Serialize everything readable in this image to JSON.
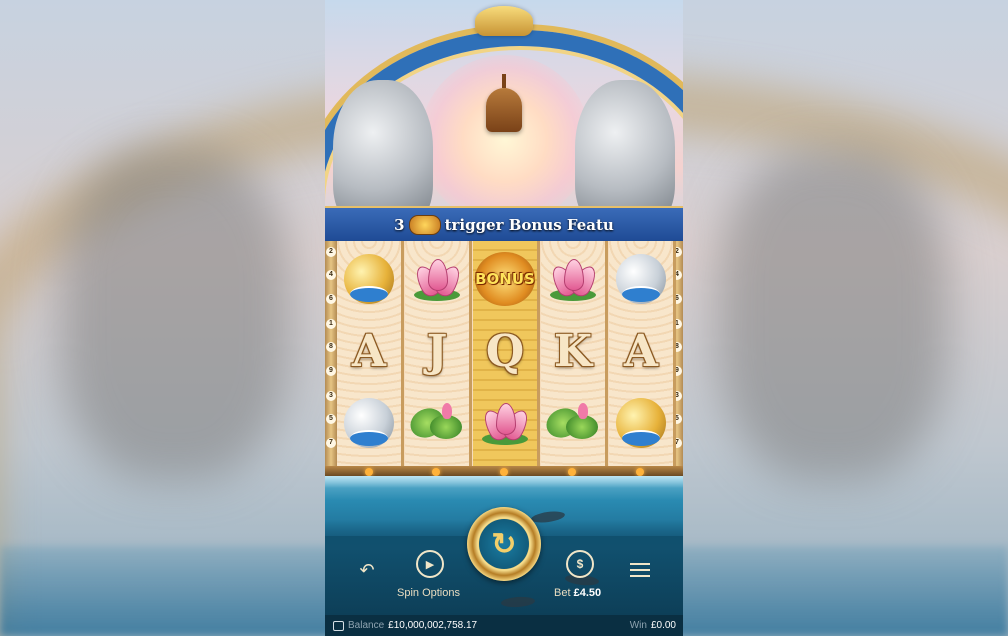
{
  "banner": {
    "prefix": "3",
    "text": "trigger Bonus Featu"
  },
  "reels": {
    "columns": [
      [
        "gold-koi",
        "A",
        "silver-koi"
      ],
      [
        "lotus",
        "J",
        "lotus-leaf"
      ],
      [
        "bonus",
        "Q",
        "lotus"
      ],
      [
        "lotus",
        "K",
        "lotus-leaf"
      ],
      [
        "silver-koi",
        "A",
        "gold-koi"
      ]
    ],
    "bonus_label": "BONUS",
    "line_numbers_left": [
      "2",
      "4",
      "6",
      "1",
      "8",
      "9",
      "3",
      "5",
      "7"
    ],
    "line_numbers_right": [
      "2",
      "4",
      "6",
      "1",
      "8",
      "9",
      "3",
      "5",
      "7"
    ]
  },
  "controls": {
    "spin_options_label": "Spin Options",
    "bet_label": "Bet",
    "bet_value": "£4.50"
  },
  "status": {
    "balance_label": "Balance",
    "balance_value": "£10,000,002,758.17",
    "win_label": "Win",
    "win_value": "£0.00"
  },
  "icons": [
    "back-icon",
    "play-icon",
    "coin-icon",
    "menu-icon",
    "wallet-icon",
    "spin-icon",
    "bell-icon"
  ]
}
